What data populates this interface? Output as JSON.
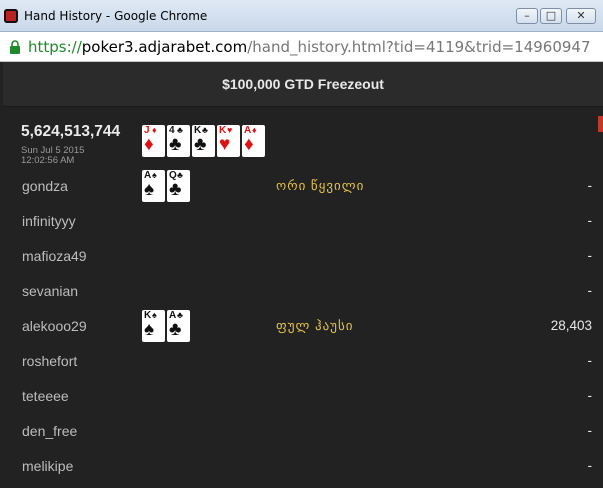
{
  "window": {
    "title": "Hand History - Google Chrome",
    "minimize_label": "–",
    "maximize_label": "□",
    "close_label": "✕"
  },
  "address_bar": {
    "scheme": "https://",
    "host": "poker3.adjarabet.com",
    "path": "/hand_history.html?tid=4119&trid=14960947"
  },
  "page": {
    "title": "$100,000 GTD Freezeout"
  },
  "hand": {
    "id": "5,624,513,744",
    "date": "Sun Jul 5 2015",
    "time": "12:02:56 AM",
    "board": [
      {
        "rank": "J",
        "suit": "♦",
        "color": "red"
      },
      {
        "rank": "4",
        "suit": "♣",
        "color": "black"
      },
      {
        "rank": "K",
        "suit": "♣",
        "color": "black"
      },
      {
        "rank": "K",
        "suit": "♥",
        "color": "red"
      },
      {
        "rank": "A",
        "suit": "♦",
        "color": "red"
      }
    ]
  },
  "players": [
    {
      "name": "gondza",
      "cards": [
        {
          "rank": "A",
          "suit": "♠",
          "color": "black"
        },
        {
          "rank": "Q",
          "suit": "♣",
          "color": "black"
        }
      ],
      "hand_rank": "ორი წყვილი",
      "amount": "-"
    },
    {
      "name": "infinityyy",
      "cards": [],
      "hand_rank": "",
      "amount": "-"
    },
    {
      "name": "mafioza49",
      "cards": [],
      "hand_rank": "",
      "amount": "-"
    },
    {
      "name": "sevanian",
      "cards": [],
      "hand_rank": "",
      "amount": "-"
    },
    {
      "name": "alekooo29",
      "cards": [
        {
          "rank": "K",
          "suit": "♠",
          "color": "black"
        },
        {
          "rank": "A",
          "suit": "♣",
          "color": "black"
        }
      ],
      "hand_rank": "ფულ ჰაუსი",
      "amount": "28,403"
    },
    {
      "name": "roshefort",
      "cards": [],
      "hand_rank": "",
      "amount": "-"
    },
    {
      "name": "teteeee",
      "cards": [],
      "hand_rank": "",
      "amount": "-"
    },
    {
      "name": "den_free",
      "cards": [],
      "hand_rank": "",
      "amount": "-"
    },
    {
      "name": "melikipe",
      "cards": [],
      "hand_rank": "",
      "amount": "-"
    }
  ],
  "colors": {
    "background": "#222222",
    "header": "#2b2b2b",
    "hand_rank_text": "#e2c247",
    "card_red": "#e01313",
    "url_scheme": "#1f8a2b"
  }
}
